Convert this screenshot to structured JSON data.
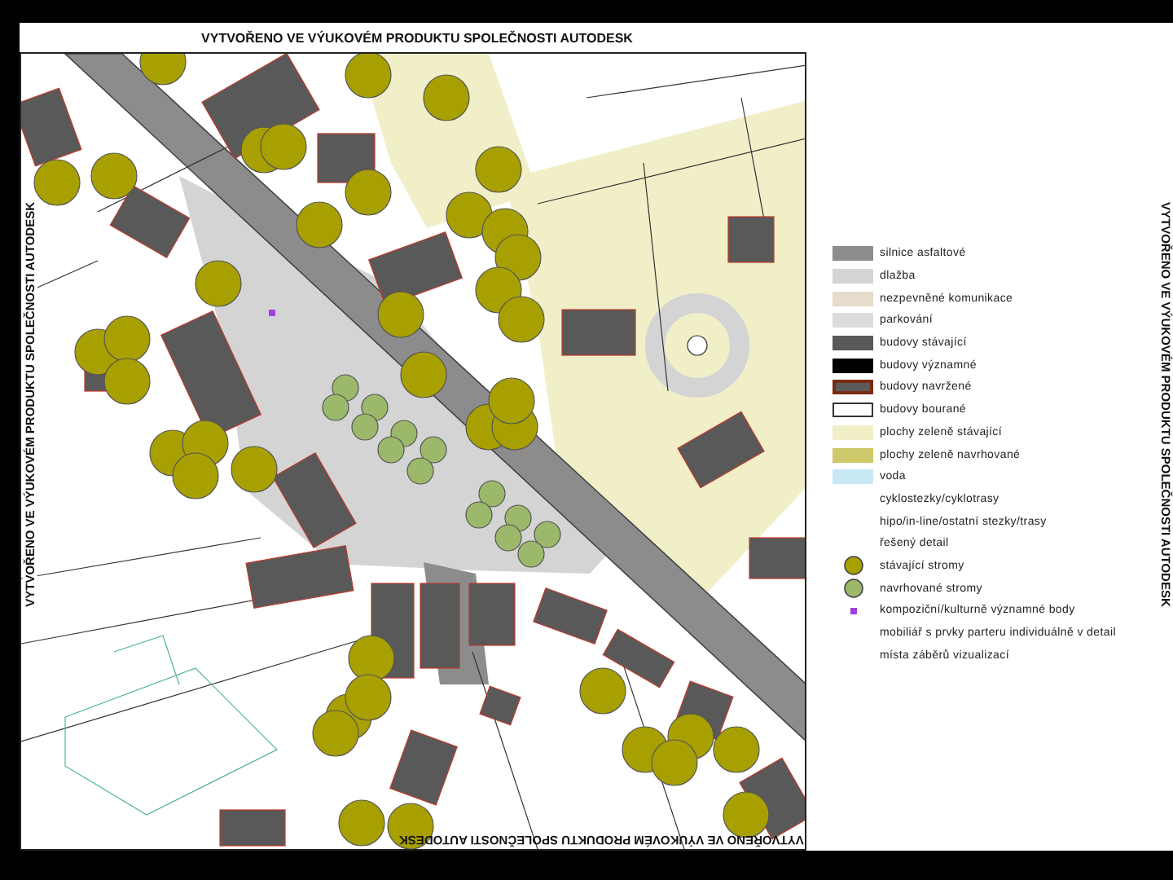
{
  "stamps": {
    "top": "VYTVOŘENO VE VÝUKOVÉM PRODUKTU SPOLEČNOSTI AUTODESK",
    "left": "VYTVOŘENO VE VÝUKOVÉM PRODUKTU SPOLEČNOSTI AUTODESK",
    "right": "VYTVOŘENO VE VÝUKOVÉM PRODUKTU SPOLEČNOSTI AUTODESK",
    "bottom": "VYTVOŘENO VE VÝUKOVÉM PRODUKTU SPOLEČNOSTI AUTODESK"
  },
  "legend": [
    {
      "kind": "fill",
      "color": "#8c8c8c",
      "label": "silnice asfaltové"
    },
    {
      "kind": "fill",
      "color": "#d4d4d4",
      "label": "dlažba"
    },
    {
      "kind": "fill",
      "color": "#e6dccb",
      "label": "nezpevněné komunikace"
    },
    {
      "kind": "fill",
      "color": "#dcdcdc",
      "label": "parkování"
    },
    {
      "kind": "fill",
      "color": "#595959",
      "label": "budovy stávající"
    },
    {
      "kind": "fill",
      "color": "#000000",
      "label": "budovy významné"
    },
    {
      "kind": "outlined",
      "color": "#5a5a5a",
      "label": "budovy navržené"
    },
    {
      "kind": "hollow",
      "color": "#ffffff",
      "label": "budovy bourané"
    },
    {
      "kind": "fill",
      "color": "#f0efc8",
      "label": "plochy zeleně stávající"
    },
    {
      "kind": "fill",
      "color": "#cdc96a",
      "label": "plochy zeleně navrhované"
    },
    {
      "kind": "fill",
      "color": "#c8e8f5",
      "label": "voda"
    },
    {
      "kind": "blank",
      "label": "cyklostezky/cyklotrasy"
    },
    {
      "kind": "blank",
      "label": "hipo/in-line/ostatní stezky/trasy"
    },
    {
      "kind": "blank",
      "label": "řešený detail"
    },
    {
      "kind": "tree",
      "color": "#a8a000",
      "label": "stávající stromy"
    },
    {
      "kind": "tree",
      "color": "#9cb86a",
      "label": "navrhované stromy"
    },
    {
      "kind": "point",
      "color": "#a040e0",
      "label": "kompoziční/kulturně významné body"
    },
    {
      "kind": "none",
      "label": "mobiliář s prvky parteru individuálně v detail"
    },
    {
      "kind": "none",
      "label": "místa záběrů vizualizací"
    }
  ]
}
